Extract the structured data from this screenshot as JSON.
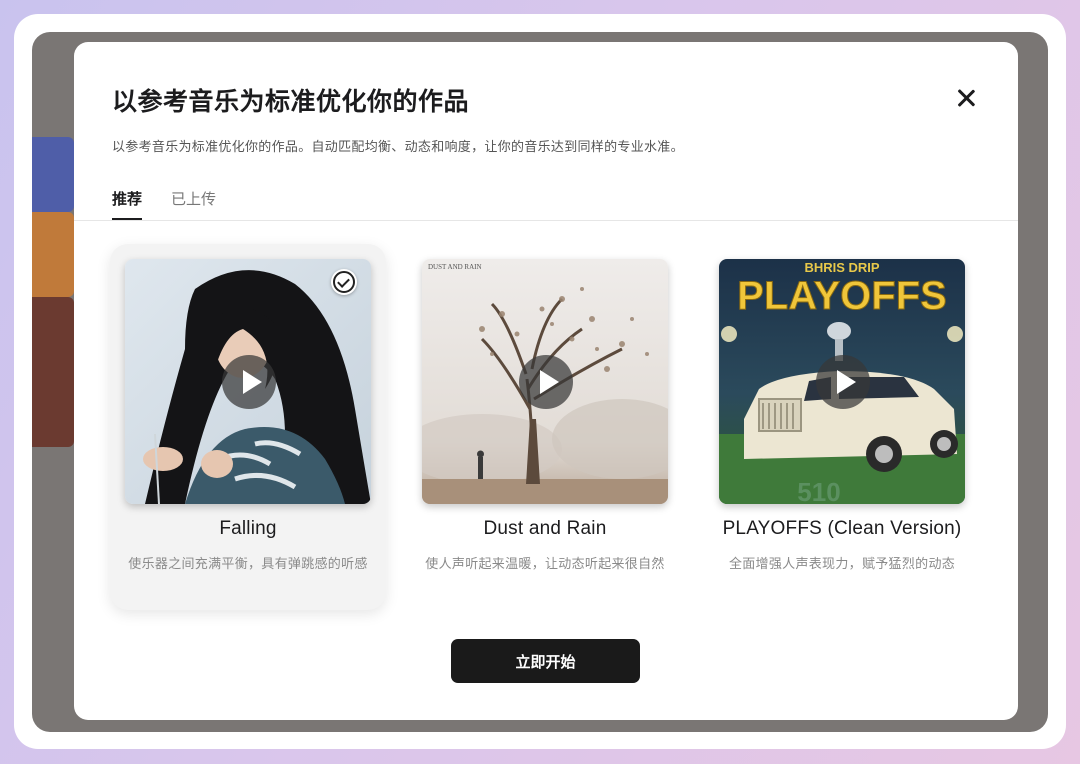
{
  "modal": {
    "title": "以参考音乐为标准优化你的作品",
    "subtitle": "以参考音乐为标准优化你的作品。自动匹配均衡、动态和响度，让你的音乐达到同样的专业水准。",
    "tabs": [
      {
        "label": "推荐",
        "active": true
      },
      {
        "label": "已上传",
        "active": false
      }
    ],
    "cards": [
      {
        "title": "Falling",
        "description": "使乐器之间充满平衡，具有弹跳感的听感",
        "selected": true
      },
      {
        "title": "Dust and Rain",
        "description": "使人声听起来温暖，让动态听起来很自然",
        "selected": false,
        "cover_text": "DUST AND RAIN"
      },
      {
        "title": "PLAYOFFS (Clean Version)",
        "description": "全面增强人声表现力，赋予猛烈的动态",
        "selected": false,
        "cover_artist": "BHRIS DRIP",
        "cover_title": "PLAYOFFS",
        "cover_number": "510"
      }
    ],
    "start_button": "立即开始"
  },
  "colors": {
    "button_bg": "#1a1a1a",
    "overlay": "#7a7674",
    "selected_card_bg": "#f3f3f3"
  },
  "icons": {
    "close": "close-icon",
    "play": "play-icon",
    "selected": "check-circle-icon"
  }
}
